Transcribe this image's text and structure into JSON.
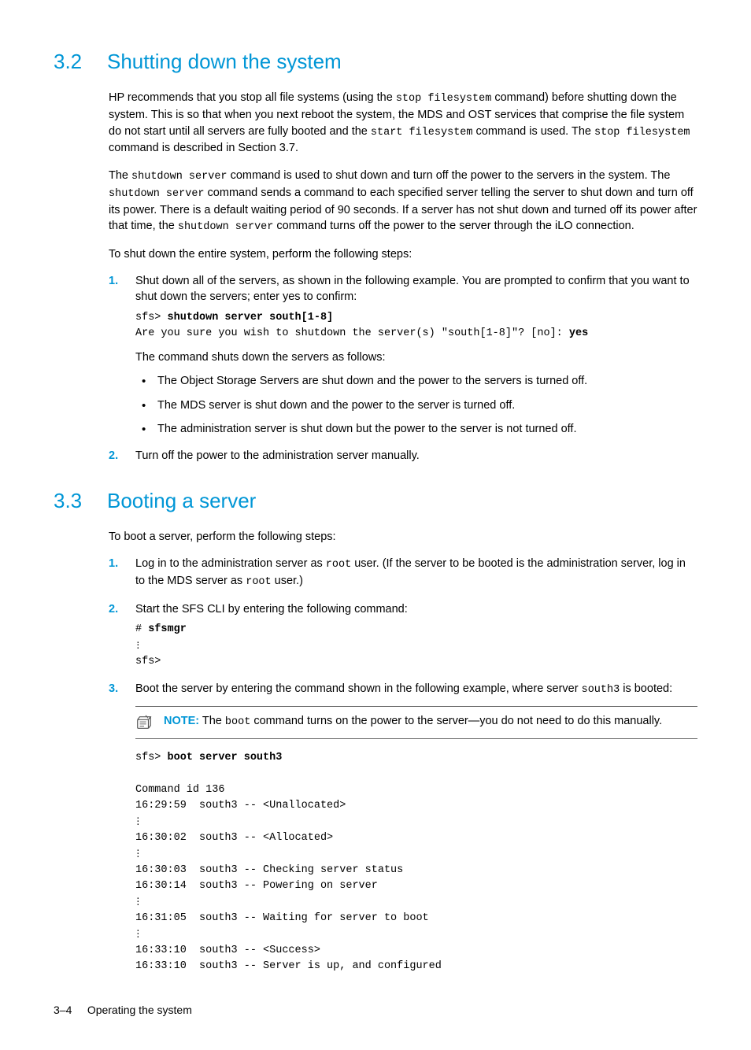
{
  "section32": {
    "number": "3.2",
    "title": "Shutting down the system",
    "para1_a": "HP recommends that you stop all file systems (using the ",
    "para1_code1": "stop filesystem",
    "para1_b": " command) before shutting down the system. This is so that when you next reboot the system, the MDS and OST services that comprise the file system do not start until all servers are fully booted and the ",
    "para1_code2": "start filesystem",
    "para1_c": " command is used. The ",
    "para1_code3": "stop filesystem",
    "para1_d": " command is described in Section 3.7.",
    "para2_a": "The ",
    "para2_code1": "shutdown server",
    "para2_b": " command is used to shut down and turn off the power to the servers in the system. The ",
    "para2_code2": "shutdown server",
    "para2_c": " command sends a command to each specified server telling the server to shut down and turn off its power. There is a default waiting period of 90 seconds. If a server has not shut down and turned off its power after that time, the ",
    "para2_code3": "shutdown server",
    "para2_d": " command turns off the power to the server through the iLO connection.",
    "para3": "To shut down the entire system, perform the following steps:",
    "step1_num": "1.",
    "step1_text": "Shut down all of the servers, as shown in the following example. You are prompted to confirm that you want to shut down the servers; enter yes to confirm:",
    "step1_code_prompt": "sfs> ",
    "step1_code_cmd": "shutdown server south[1-8]",
    "step1_code_line2a": "Are you sure you wish to shutdown the server(s) \"south[1-8]\"? [no]: ",
    "step1_code_line2b": "yes",
    "step1_after": "The command shuts down the servers as follows:",
    "bullet1": "The Object Storage Servers are shut down and the power to the servers is turned off.",
    "bullet2": "The MDS server is shut down and the power to the server is turned off.",
    "bullet3": "The administration server is shut down but the power to the server is not turned off.",
    "step2_num": "2.",
    "step2_text": "Turn off the power to the administration server manually."
  },
  "section33": {
    "number": "3.3",
    "title": "Booting a server",
    "para1": "To boot a server, perform the following steps:",
    "step1_num": "1.",
    "step1_a": "Log in to the administration server as ",
    "step1_code1": "root",
    "step1_b": " user. (If the server to be booted is the administration server, log in to the MDS server as ",
    "step1_code2": "root",
    "step1_c": " user.)",
    "step2_num": "2.",
    "step2_text": "Start the SFS CLI by entering the following command:",
    "step2_code_prompt": "# ",
    "step2_code_cmd": "sfsmgr",
    "step2_code_out": "sfs>",
    "step3_num": "3.",
    "step3_a": "Boot the server by entering the command shown in the following example, where server ",
    "step3_code1": "south3",
    "step3_b": " is booted:",
    "note_label": "NOTE:",
    "note_a": "   The ",
    "note_code": "boot",
    "note_b": " command turns on the power to the server—you do not need to do this manually.",
    "boot_prompt": "sfs> ",
    "boot_cmd": "boot server south3",
    "boot_l1": "Command id 136",
    "boot_l2": "16:29:59  south3 -- <Unallocated>",
    "boot_l3": "16:30:02  south3 -- <Allocated>",
    "boot_l4": "16:30:03  south3 -- Checking server status",
    "boot_l5": "16:30:14  south3 -- Powering on server",
    "boot_l6": "16:31:05  south3 -- Waiting for server to boot",
    "boot_l7": "16:33:10  south3 -- <Success>",
    "boot_l8": "16:33:10  south3 -- Server is up, and configured"
  },
  "footer": {
    "page": "3–4",
    "title": "Operating the system"
  }
}
